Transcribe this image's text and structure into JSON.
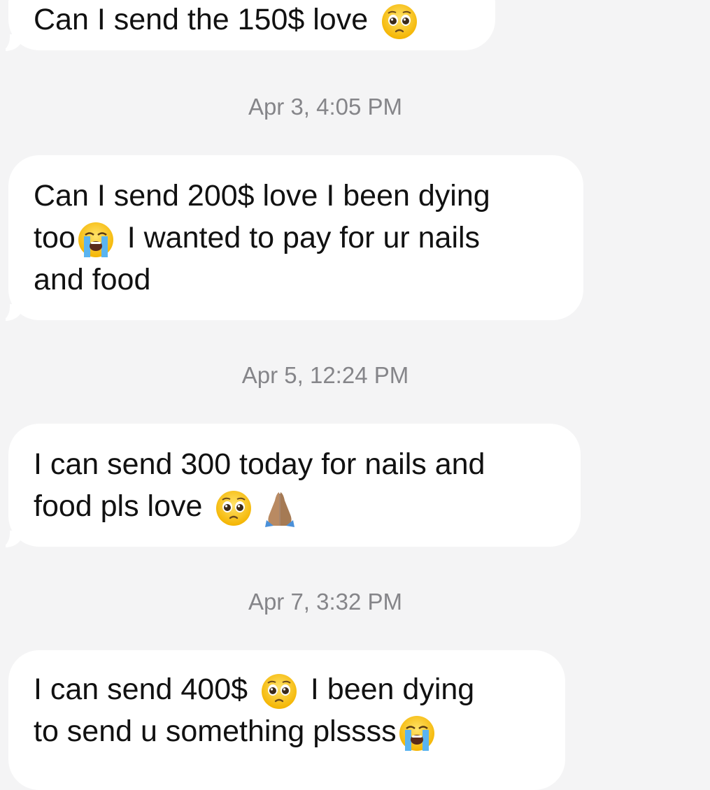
{
  "messages": [
    {
      "lines": [
        "Can I send the 150$ love "
      ],
      "emoji_icons": [
        "pleading-face-icon"
      ]
    },
    {
      "lines": [
        "Can I send 200$ love I been dying",
        "too",
        " I wanted to pay for ur nails",
        "and food"
      ],
      "emoji_icons": [
        "loudly-crying-face-icon"
      ]
    },
    {
      "lines": [
        "I can send 300 today for nails and",
        "food pls love "
      ],
      "emoji_icons": [
        "pleading-face-icon",
        "folded-hands-icon"
      ]
    },
    {
      "lines": [
        "I can send 400$ ",
        " I been dying",
        "to send u something plssss"
      ],
      "emoji_icons": [
        "pleading-face-icon",
        "loudly-crying-face-icon"
      ]
    }
  ],
  "timestamps": [
    "Apr 3, 4:05 PM",
    "Apr 5, 12:24 PM",
    "Apr 7, 3:32 PM"
  ],
  "colors": {
    "background": "#f4f4f5",
    "bubble": "#ffffff",
    "text": "#111111",
    "timestamp": "#858589"
  }
}
